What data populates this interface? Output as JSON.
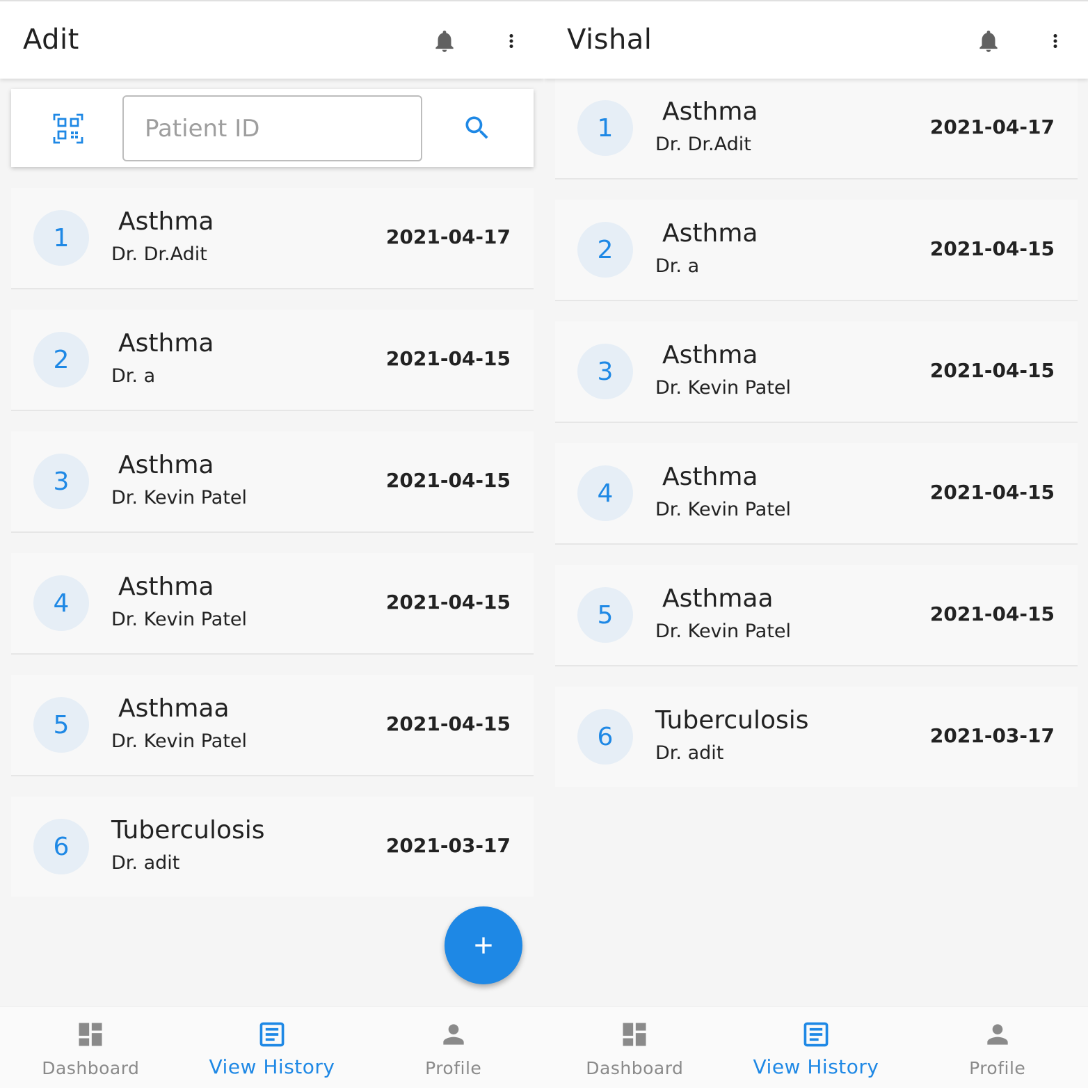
{
  "screens": [
    {
      "title": "Adit",
      "has_search": true,
      "search": {
        "placeholder": "Patient ID",
        "value": ""
      },
      "records": [
        {
          "num": "1",
          "disease": "Asthma",
          "doctor": "Dr. Dr.Adit",
          "date": "2021-04-17"
        },
        {
          "num": "2",
          "disease": "Asthma",
          "doctor": "Dr. a",
          "date": "2021-04-15"
        },
        {
          "num": "3",
          "disease": "Asthma",
          "doctor": "Dr. Kevin Patel",
          "date": "2021-04-15"
        },
        {
          "num": "4",
          "disease": "Asthma",
          "doctor": "Dr. Kevin Patel",
          "date": "2021-04-15"
        },
        {
          "num": "5",
          "disease": "Asthmaa",
          "doctor": "Dr. Kevin Patel",
          "date": "2021-04-15"
        },
        {
          "num": "6",
          "disease": "Tuberculosis",
          "doctor": "Dr. adit",
          "date": "2021-03-17"
        }
      ],
      "has_fab": true,
      "fab_icon": "plus-icon",
      "nav": [
        {
          "label": "Dashboard",
          "icon": "dashboard-icon",
          "active": false
        },
        {
          "label": "View History",
          "icon": "history-icon",
          "active": true
        },
        {
          "label": "Profile",
          "icon": "person-icon",
          "active": false
        }
      ]
    },
    {
      "title": "Vishal",
      "has_search": false,
      "records": [
        {
          "num": "1",
          "disease": "Asthma",
          "doctor": "Dr. Dr.Adit",
          "date": "2021-04-17"
        },
        {
          "num": "2",
          "disease": "Asthma",
          "doctor": "Dr. a",
          "date": "2021-04-15"
        },
        {
          "num": "3",
          "disease": "Asthma",
          "doctor": "Dr. Kevin Patel",
          "date": "2021-04-15"
        },
        {
          "num": "4",
          "disease": "Asthma",
          "doctor": "Dr. Kevin Patel",
          "date": "2021-04-15"
        },
        {
          "num": "5",
          "disease": "Asthmaa",
          "doctor": "Dr. Kevin Patel",
          "date": "2021-04-15"
        },
        {
          "num": "6",
          "disease": "Tuberculosis",
          "doctor": "Dr. adit",
          "date": "2021-03-17"
        }
      ],
      "has_fab": false,
      "nav": [
        {
          "label": "Dashboard",
          "icon": "dashboard-icon",
          "active": false
        },
        {
          "label": "View History",
          "icon": "history-icon",
          "active": true
        },
        {
          "label": "Profile",
          "icon": "person-icon",
          "active": false
        }
      ]
    }
  ],
  "colors": {
    "accent": "#1e88e5",
    "inactive": "#8a8a8a",
    "avatar_bg": "#e6eef6",
    "card_bg": "#f8f8f8"
  }
}
